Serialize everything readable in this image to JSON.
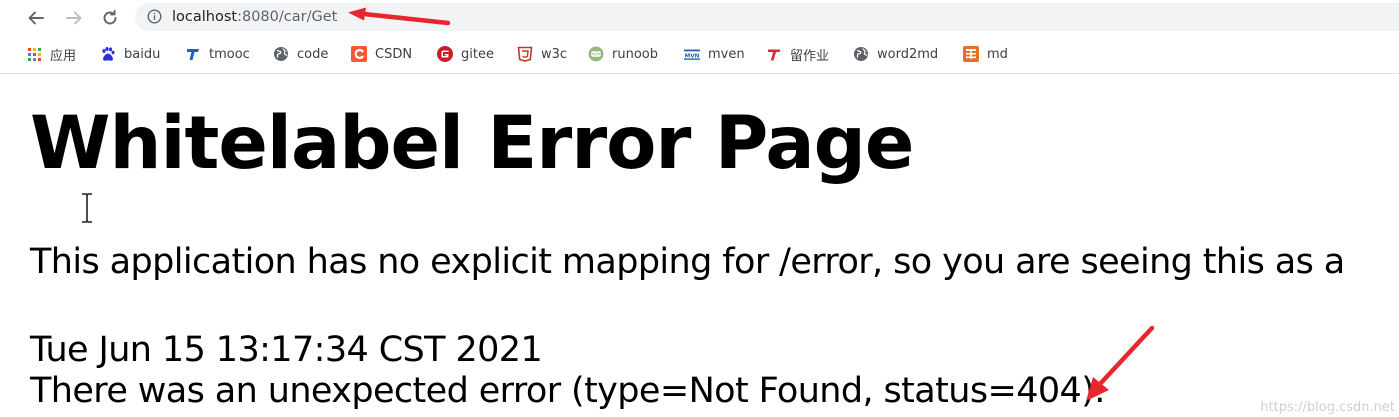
{
  "browser": {
    "url_host": "localhost",
    "url_rest": ":8080/car/Get"
  },
  "bookmarks": [
    {
      "label": "应用",
      "icon": "apps-grid-icon"
    },
    {
      "label": "baidu",
      "icon": "baidu-paw-icon"
    },
    {
      "label": "tmooc",
      "icon": "tmooc-icon"
    },
    {
      "label": "code",
      "icon": "globe-icon"
    },
    {
      "label": "CSDN",
      "icon": "csdn-icon"
    },
    {
      "label": "gitee",
      "icon": "gitee-icon"
    },
    {
      "label": "w3c",
      "icon": "w3c-icon"
    },
    {
      "label": "runoob",
      "icon": "runoob-icon"
    },
    {
      "label": "mven",
      "icon": "mvn-icon"
    },
    {
      "label": "留作业",
      "icon": "t-logo-icon"
    },
    {
      "label": "word2md",
      "icon": "globe-icon"
    },
    {
      "label": "md",
      "icon": "jian-icon"
    }
  ],
  "page": {
    "title": "Whitelabel Error Page",
    "message": "This application has no explicit mapping for /error, so you are seeing this as a",
    "timestamp": "Tue Jun 15 13:17:34 CST 2021",
    "error_line": "There was an unexpected error (type=Not Found, status=404)."
  },
  "watermark": "https://blog.csdn.net",
  "colors": {
    "annotation_arrow": "#e8262d",
    "omnibox_bg": "#f1f3f4",
    "csdn": "#fc5531",
    "gitee": "#c71d23",
    "mvn": "#1a5fb4"
  }
}
